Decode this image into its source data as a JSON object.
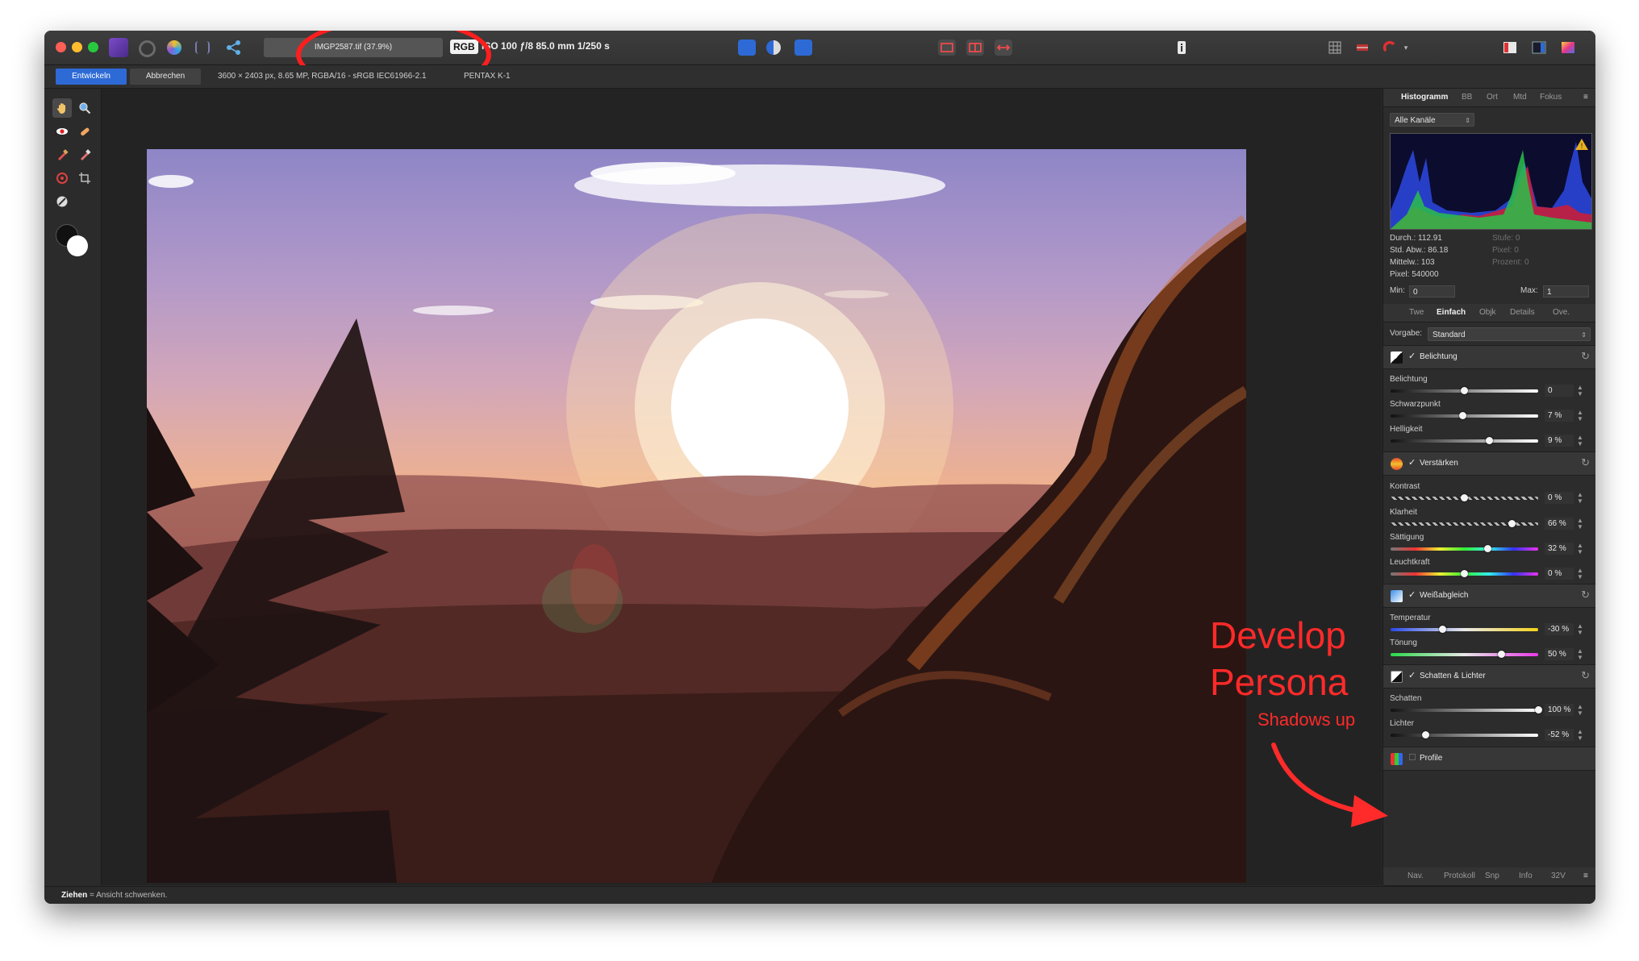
{
  "titlebar": {
    "file_name": "IMGP2587.tif (37.9%)",
    "color_mode": "RGB",
    "exif": "ISO 100 ƒ/8 85.0 mm 1/250 s"
  },
  "context_bar": {
    "develop_button": "Entwickeln",
    "cancel_button": "Abbrechen",
    "image_info": "3600 × 2403 px, 8.65 MP, RGBA/16 - sRGB IEC61966-2.1",
    "camera": "PENTAX K-1"
  },
  "histogram_panel": {
    "tabs": [
      "Histogramm",
      "BB",
      "Ort",
      "Mtd",
      "Fokus"
    ],
    "channel": "Alle Kanäle",
    "stats_left": [
      "Durch.: 112.91",
      "Std. Abw.: 86.18",
      "Mittelw.: 103",
      "Pixel: 540000"
    ],
    "stats_right": [
      "Stufe: 0",
      "Pixel: 0",
      "Prozent: 0"
    ],
    "min_label": "Min:",
    "min_value": "0",
    "max_label": "Max:",
    "max_value": "1"
  },
  "adjust_panel": {
    "tabs": [
      "Twe",
      "Einfach",
      "Objk",
      "Details",
      "Ove."
    ],
    "preset_label": "Vorgabe:",
    "preset_value": "Standard",
    "check": "✓",
    "sections": {
      "exposure": {
        "title": "Belichtung",
        "sliders": [
          {
            "label": "Belichtung",
            "value": "0",
            "fraction": 0.5
          },
          {
            "label": "Schwarzpunkt",
            "value": "7 %",
            "fraction": 0.49
          },
          {
            "label": "Helligkeit",
            "value": "9 %",
            "fraction": 0.67
          }
        ]
      },
      "enhance": {
        "title": "Verstärken",
        "sliders": [
          {
            "label": "Kontrast",
            "value": "0 %",
            "fraction": 0.5
          },
          {
            "label": "Klarheit",
            "value": "66 %",
            "fraction": 0.82
          },
          {
            "label": "Sättigung",
            "value": "32 %",
            "fraction": 0.66
          },
          {
            "label": "Leuchtkraft",
            "value": "0 %",
            "fraction": 0.5
          }
        ]
      },
      "white_balance": {
        "title": "Weißabgleich",
        "sliders": [
          {
            "label": "Temperatur",
            "value": "-30 %",
            "fraction": 0.35
          },
          {
            "label": "Tönung",
            "value": "50 %",
            "fraction": 0.75
          }
        ]
      },
      "shadows_highlights": {
        "title": "Schatten & Lichter",
        "sliders": [
          {
            "label": "Schatten",
            "value": "100 %",
            "fraction": 1.0
          },
          {
            "label": "Lichter",
            "value": "-52 %",
            "fraction": 0.24
          }
        ]
      },
      "profiles": {
        "title": "Profile"
      }
    }
  },
  "bottom_panel_tabs": [
    "Nav.",
    "Protokoll",
    "Snp",
    "Info",
    "32V"
  ],
  "status": {
    "action": "Ziehen",
    "hint": " = Ansicht schwenken."
  },
  "annotation": {
    "title_line1": "Develop",
    "title_line2": "Persona",
    "subtitle": "Shadows up"
  },
  "colors": {
    "accent_blue": "#2d6ad6",
    "annotation_red": "#ff2a2a"
  }
}
